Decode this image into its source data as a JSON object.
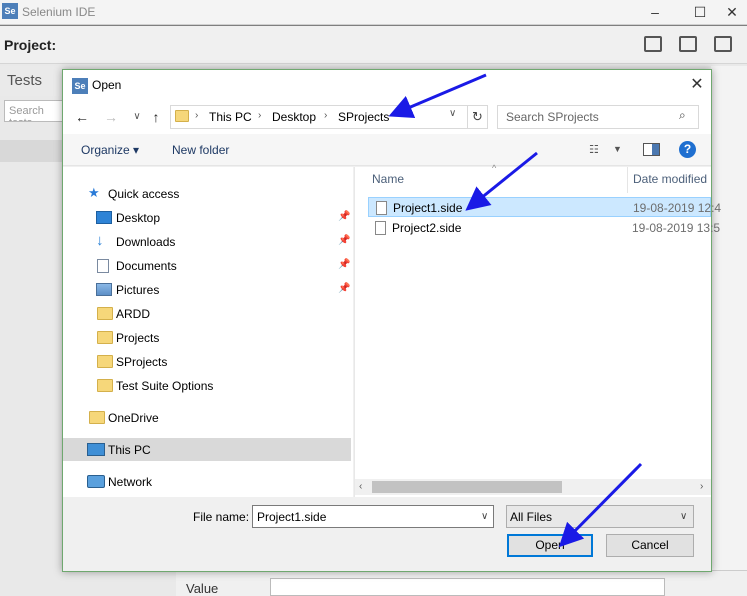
{
  "app": {
    "title": "Selenium IDE",
    "logo_text": "Se"
  },
  "background": {
    "project_label": "Project:",
    "tests_label": "Tests",
    "search_placeholder": "Search tests",
    "value_label": "Value"
  },
  "dialog": {
    "title": "Open",
    "logo_text": "Se",
    "address": {
      "crumbs": [
        "This PC",
        "Desktop",
        "SProjects"
      ]
    },
    "search_placeholder": "Search SProjects",
    "toolbar": {
      "organize": "Organize",
      "new_folder": "New folder",
      "help": "?"
    },
    "nav": {
      "quick_access": "Quick access",
      "pinned": [
        {
          "label": "Desktop",
          "icon": "desktop-icon"
        },
        {
          "label": "Downloads",
          "icon": "downloads-icon"
        },
        {
          "label": "Documents",
          "icon": "documents-icon"
        },
        {
          "label": "Pictures",
          "icon": "pictures-icon"
        }
      ],
      "folders": [
        "ARDD",
        "Projects",
        "SProjects",
        "Test Suite Options"
      ],
      "onedrive": "OneDrive",
      "this_pc": "This PC",
      "network": "Network"
    },
    "columns": {
      "name": "Name",
      "date_modified": "Date modified"
    },
    "files": [
      {
        "name": "Project1.side",
        "date": "19-08-2019 12:4",
        "selected": true
      },
      {
        "name": "Project2.side",
        "date": "19-08-2019 13:5",
        "selected": false
      }
    ],
    "file_name_label": "File name:",
    "file_name_value": "Project1.side",
    "filter": "All Files",
    "open_button": "Open",
    "cancel_button": "Cancel"
  },
  "colors": {
    "selection": "#cce8ff",
    "accent": "#0078d7",
    "annotation_arrow": "#1a1ae6"
  }
}
